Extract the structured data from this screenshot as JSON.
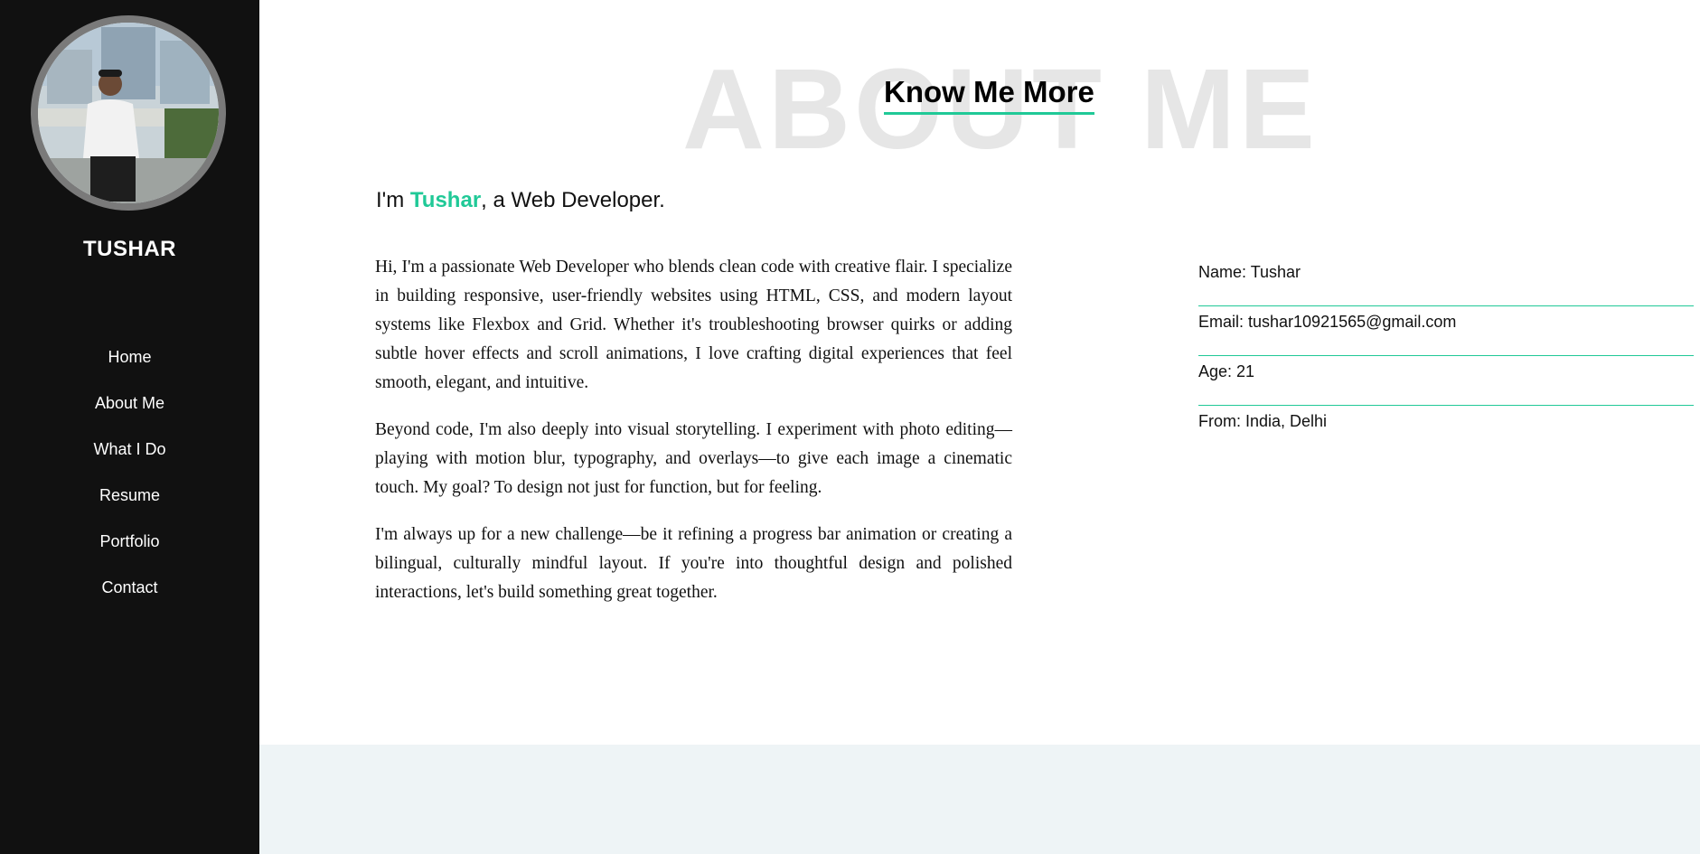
{
  "sidebar": {
    "avatar_icon": "profile-photo",
    "brand": "TUSHAR",
    "nav": [
      {
        "label": "Home"
      },
      {
        "label": "About Me"
      },
      {
        "label": "What I Do"
      },
      {
        "label": "Resume"
      },
      {
        "label": "Portfolio"
      },
      {
        "label": "Contact"
      }
    ]
  },
  "about": {
    "watermark": "ABOUT ME",
    "heading": "Know Me More",
    "intro_prefix": "I'm ",
    "intro_name": "Tushar",
    "intro_suffix": ", a Web Developer.",
    "paragraphs": [
      "Hi, I'm a passionate Web Developer who blends clean code with creative flair. I specialize in building responsive, user-friendly websites using HTML, CSS, and modern layout systems like Flexbox and Grid. Whether it's troubleshooting browser quirks or adding subtle hover effects and scroll animations, I love crafting digital experiences that feel smooth, elegant, and intuitive.",
      "Beyond code, I'm also deeply into visual storytelling. I experiment with photo editing—playing with motion blur, typography, and overlays—to give each image a cinematic touch. My goal? To design not just for function, but for feeling.",
      "I'm always up for a new challenge—be it refining a progress bar animation or creating a bilingual, culturally mindful layout. If you're into thoughtful design and polished interactions, let's build something great together."
    ],
    "info": [
      {
        "text": "Name: Tushar"
      },
      {
        "text": "Email: tushar10921565@gmail.com"
      },
      {
        "text": "Age: 21"
      },
      {
        "text": "From: India, Delhi"
      }
    ]
  },
  "colors": {
    "accent": "#20c997",
    "sidebar_bg": "#111111",
    "watermark": "#e6e6e6",
    "band_bg": "#eef4f6"
  }
}
